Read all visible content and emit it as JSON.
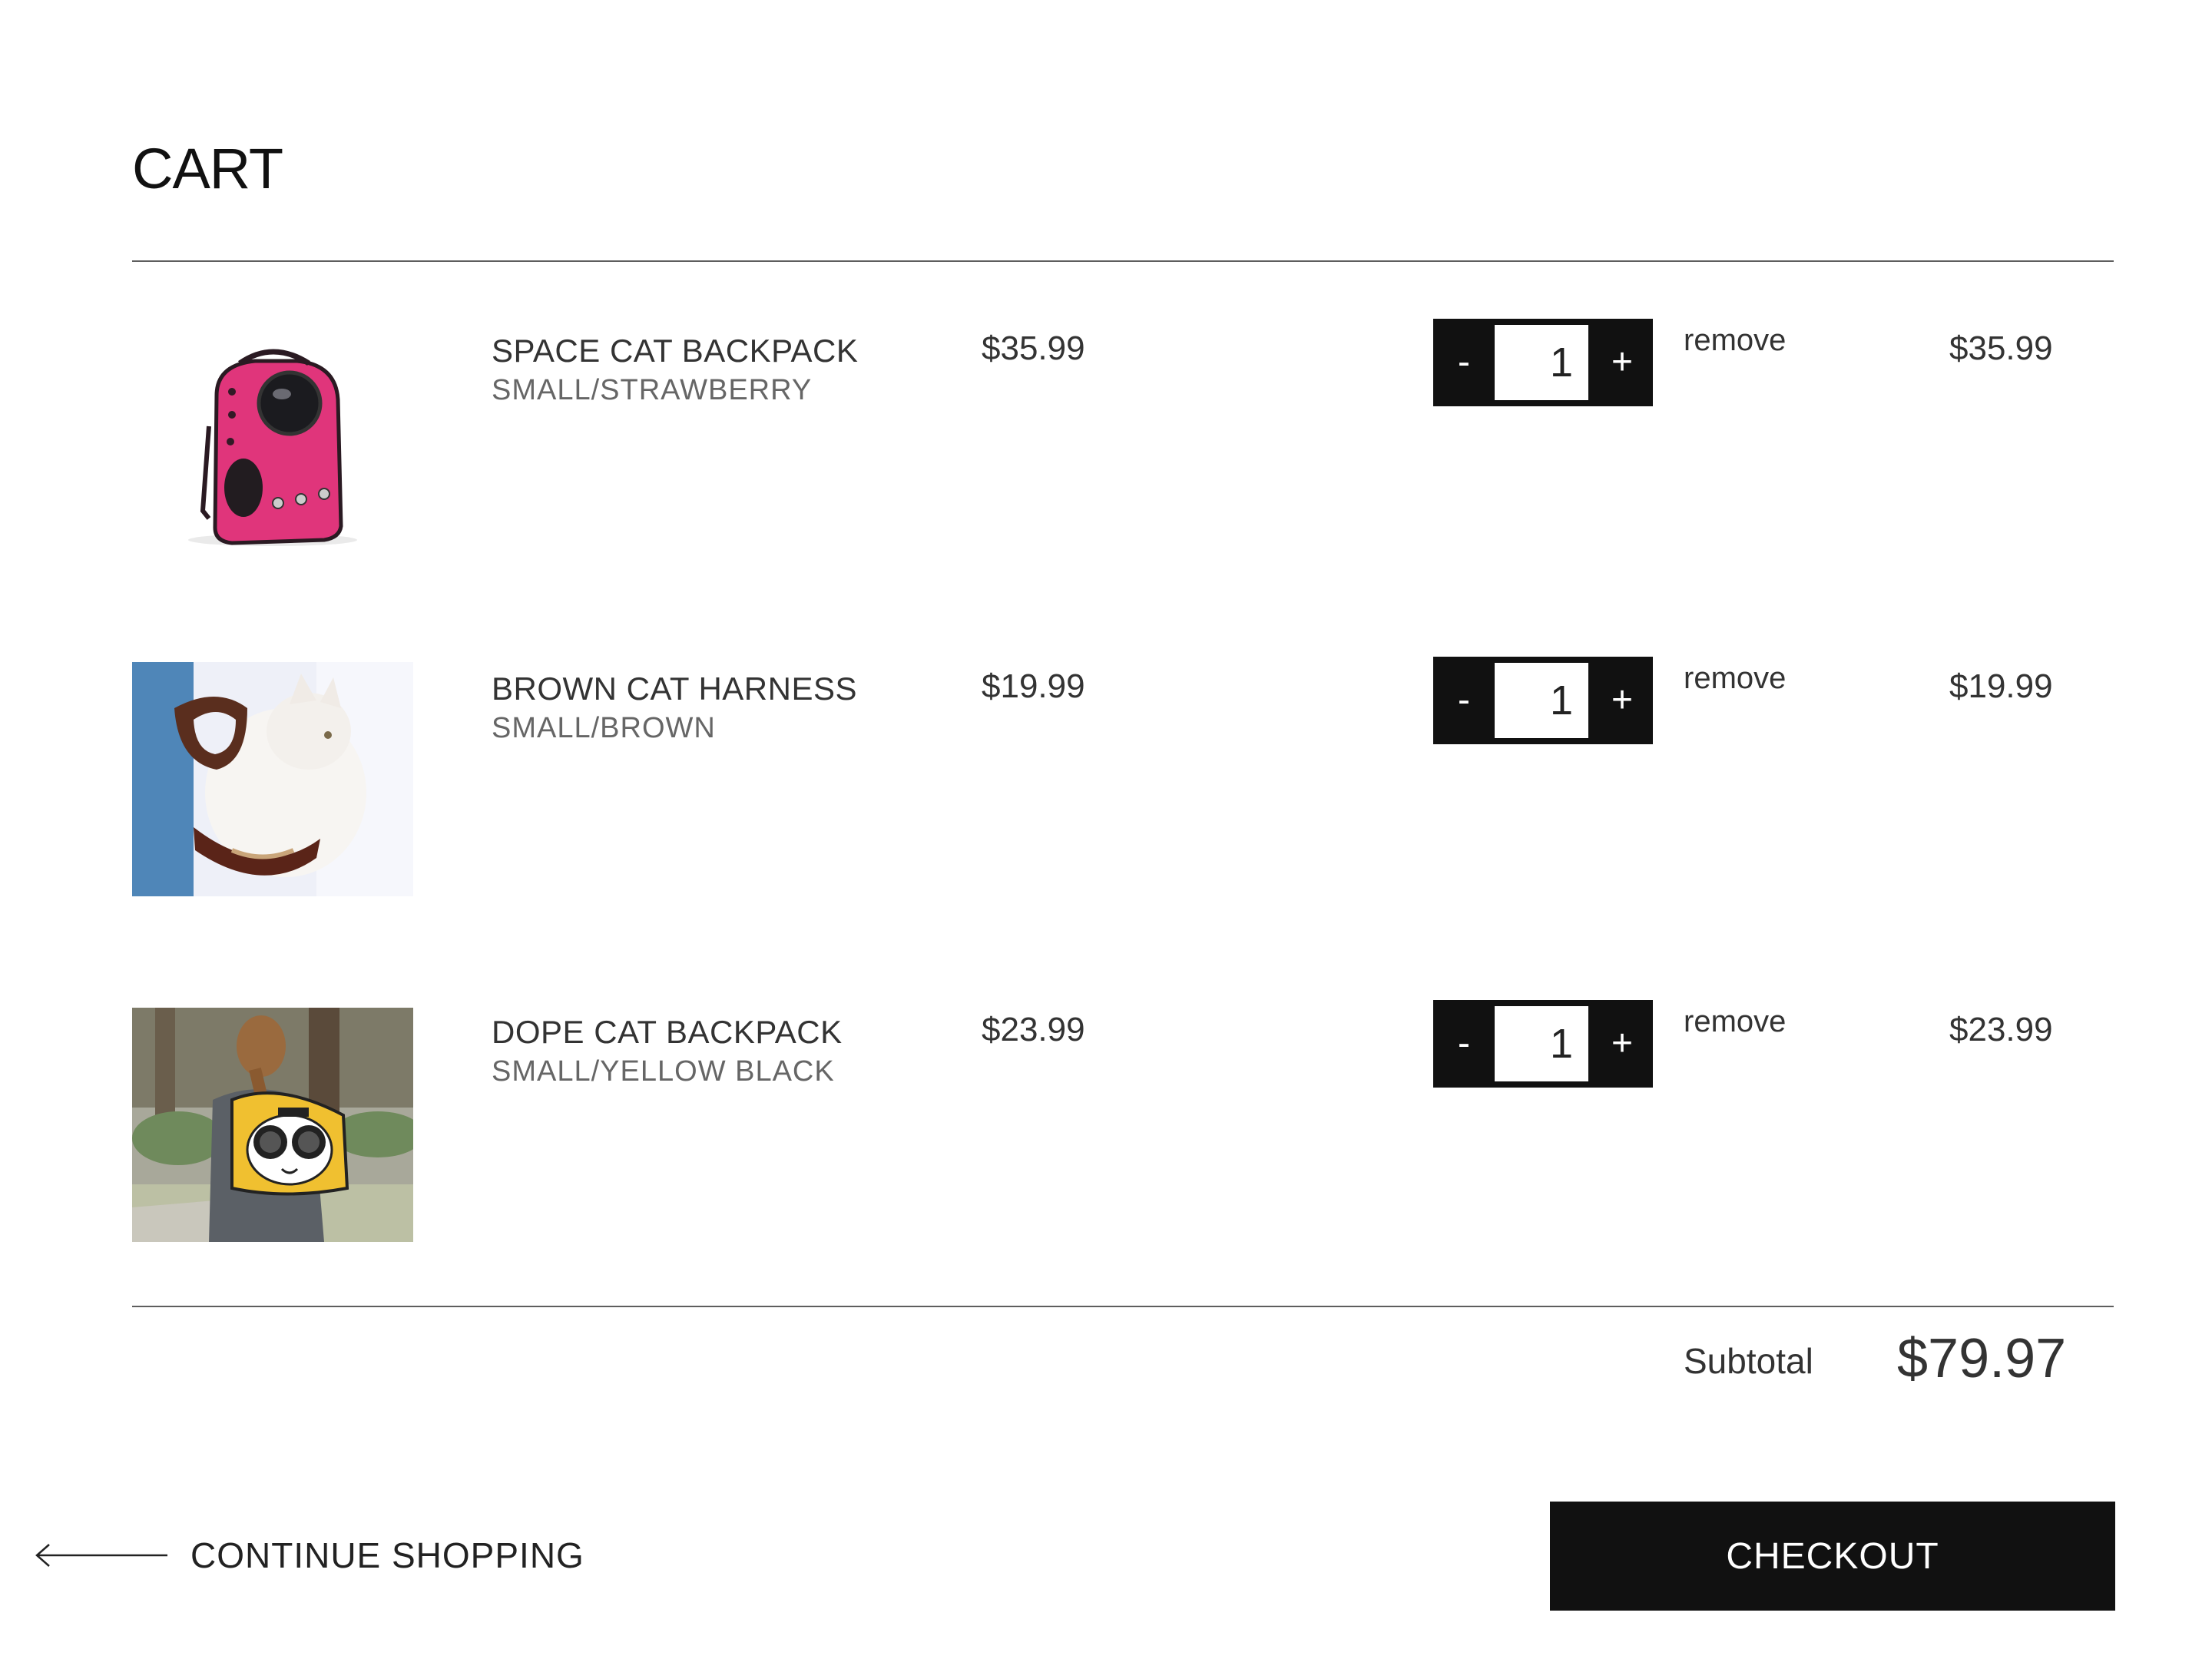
{
  "cart": {
    "title": "CART",
    "items": [
      {
        "name": "SPACE CAT BACKPACK",
        "variant": "SMALL/STRAWBERRY",
        "price": "$35.99",
        "quantity": "1",
        "minus_label": "-",
        "plus_label": "+",
        "remove_label": "remove",
        "line_total": "$35.99"
      },
      {
        "name": "BROWN CAT HARNESS",
        "variant": "SMALL/BROWN",
        "price": "$19.99",
        "quantity": "1",
        "minus_label": "-",
        "plus_label": "+",
        "remove_label": "remove",
        "line_total": "$19.99"
      },
      {
        "name": "DOPE CAT BACKPACK",
        "variant": "SMALL/YELLOW BLACK",
        "price": "$23.99",
        "quantity": "1",
        "minus_label": "-",
        "plus_label": "+",
        "remove_label": "remove",
        "line_total": "$23.99"
      }
    ],
    "subtotal_label": "Subtotal",
    "subtotal_value": "$79.97"
  },
  "footer": {
    "continue_label": "CONTINUE SHOPPING",
    "checkout_label": "CHECKOUT"
  },
  "colors": {
    "button_bg": "#111111",
    "divider": "#5e5e5e",
    "text": "#333333"
  },
  "icons": {
    "continue_arrow": "left-arrow-icon"
  }
}
